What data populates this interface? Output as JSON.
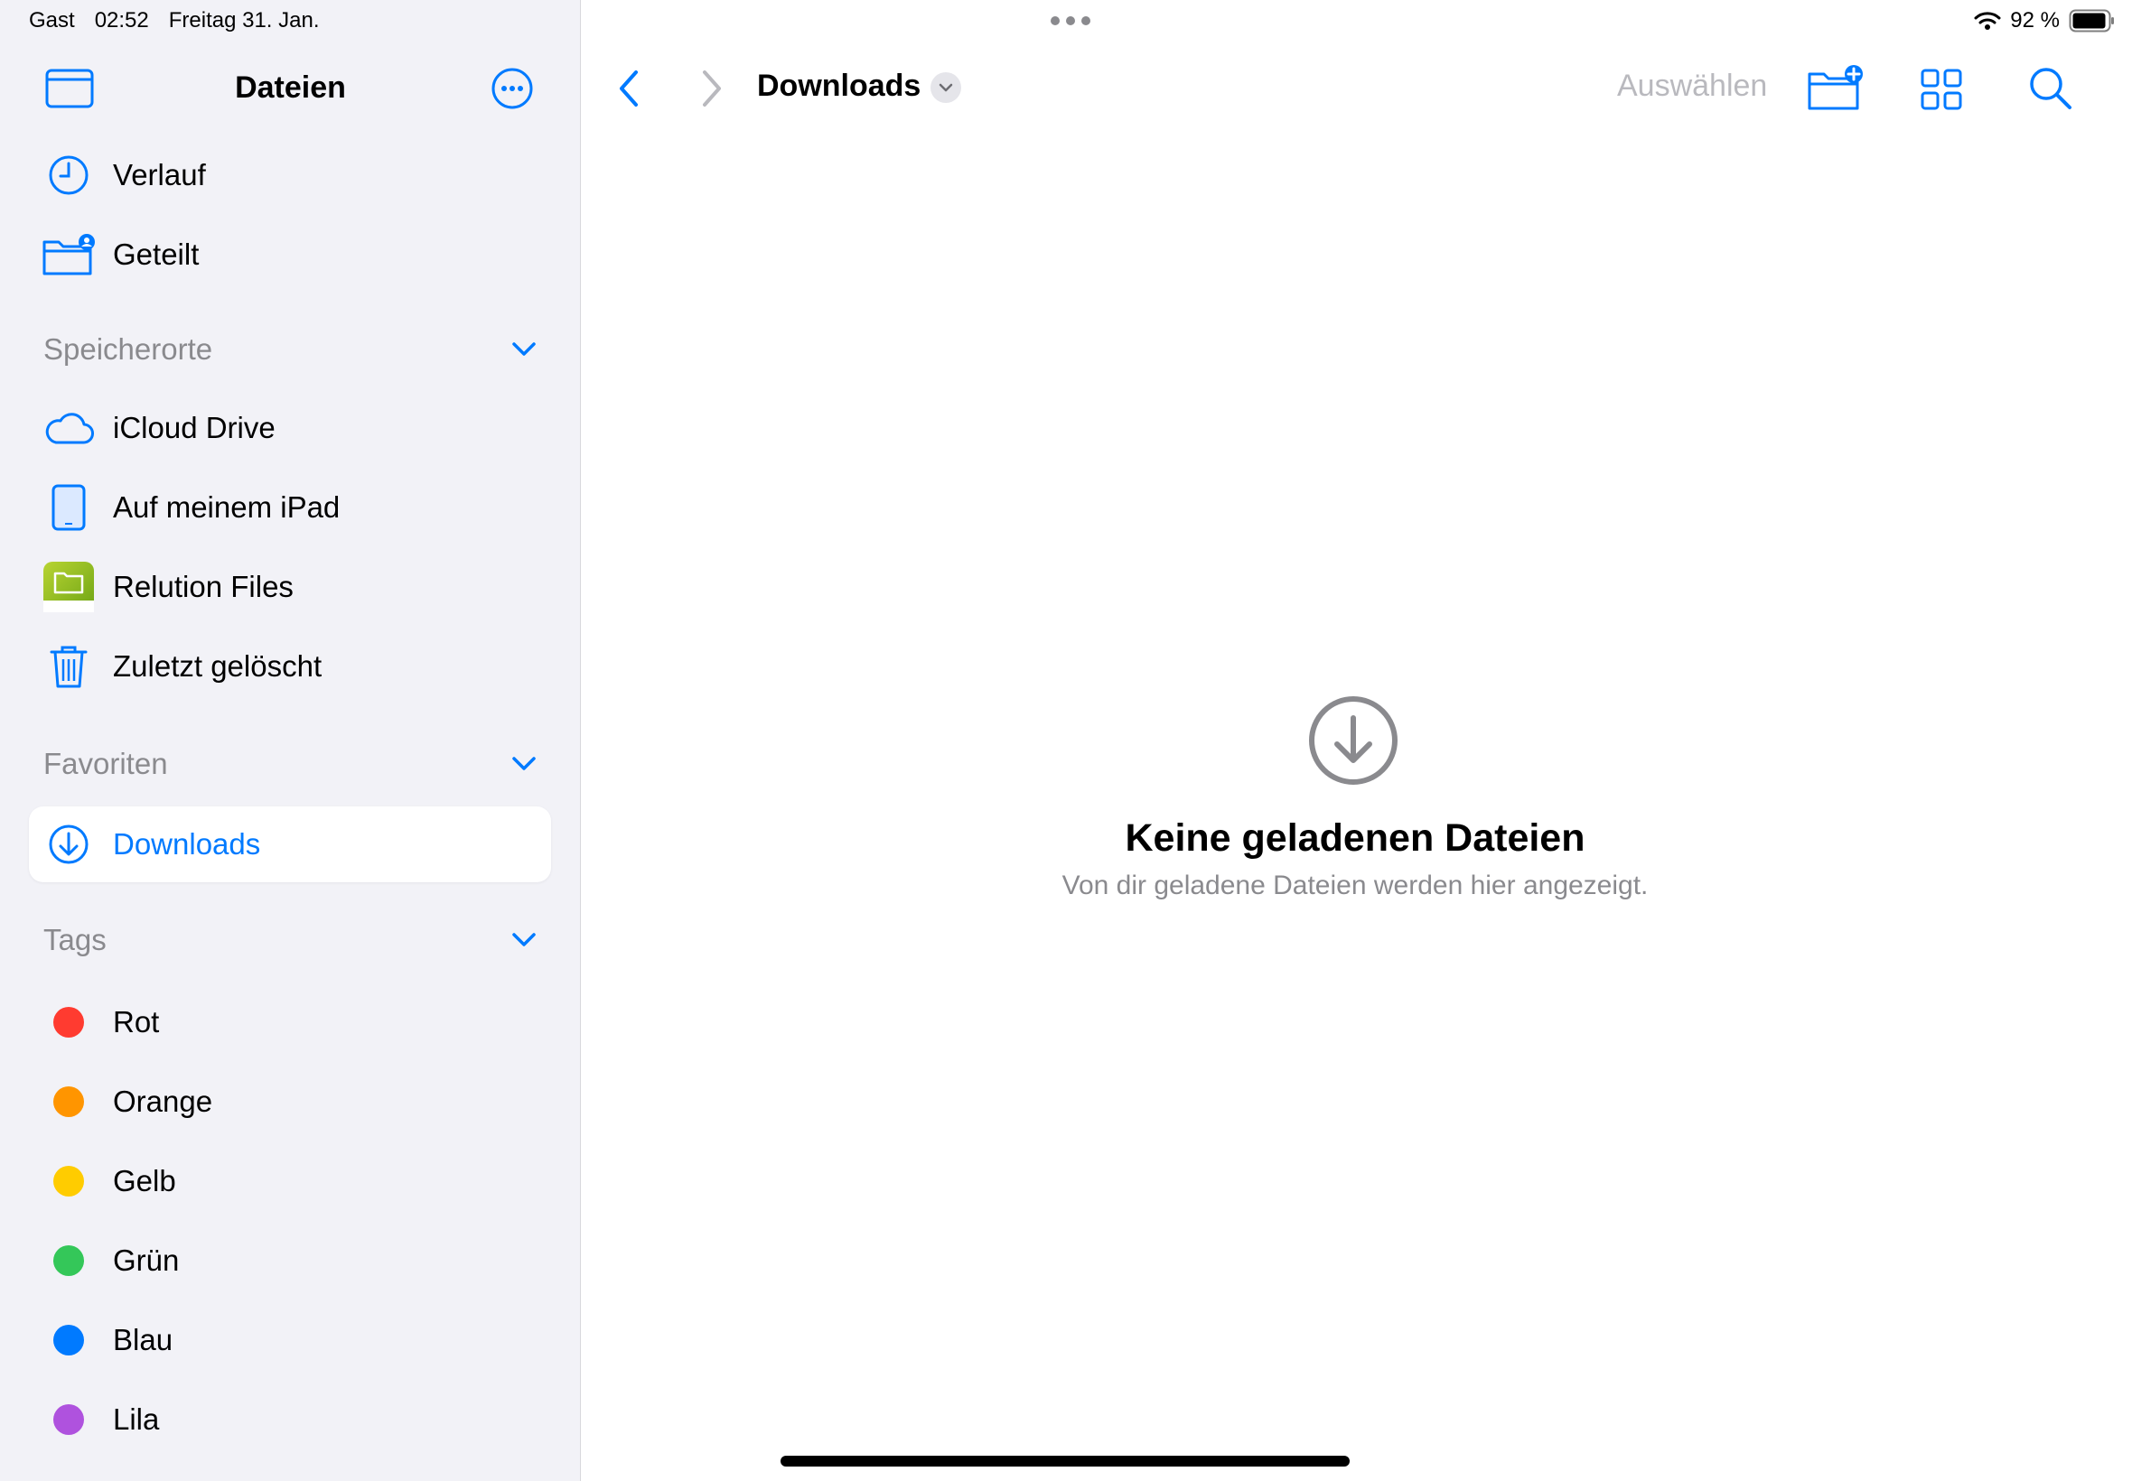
{
  "status_bar": {
    "user": "Gast",
    "time": "02:52",
    "date": "Freitag 31. Jan.",
    "battery": "92 %"
  },
  "sidebar": {
    "title": "Dateien",
    "top_items": [
      {
        "label": "Verlauf",
        "icon": "clock-icon"
      },
      {
        "label": "Geteilt",
        "icon": "shared-folder-icon"
      }
    ],
    "locations_title": "Speicherorte",
    "locations": [
      {
        "label": "iCloud Drive",
        "icon": "cloud-icon"
      },
      {
        "label": "Auf meinem iPad",
        "icon": "ipad-icon"
      },
      {
        "label": "Relution Files",
        "icon": "relution-app-icon"
      },
      {
        "label": "Zuletzt gelöscht",
        "icon": "trash-icon"
      }
    ],
    "favorites_title": "Favoriten",
    "favorites": [
      {
        "label": "Downloads",
        "icon": "download-icon",
        "selected": true
      }
    ],
    "tags_title": "Tags",
    "tags": [
      {
        "label": "Rot",
        "color": "#ff3b30"
      },
      {
        "label": "Orange",
        "color": "#ff9500"
      },
      {
        "label": "Gelb",
        "color": "#ffcc00"
      },
      {
        "label": "Grün",
        "color": "#34c759"
      },
      {
        "label": "Blau",
        "color": "#007aff"
      },
      {
        "label": "Lila",
        "color": "#af52de"
      }
    ]
  },
  "toolbar": {
    "location": "Downloads",
    "select_label": "Auswählen"
  },
  "empty_state": {
    "title": "Keine geladenen Dateien",
    "subtitle": "Von dir geladene Dateien werden hier angezeigt."
  },
  "colors": {
    "accent": "#007aff",
    "sidebar_bg": "#f2f2f7",
    "secondary_text": "#8a8a8e"
  }
}
